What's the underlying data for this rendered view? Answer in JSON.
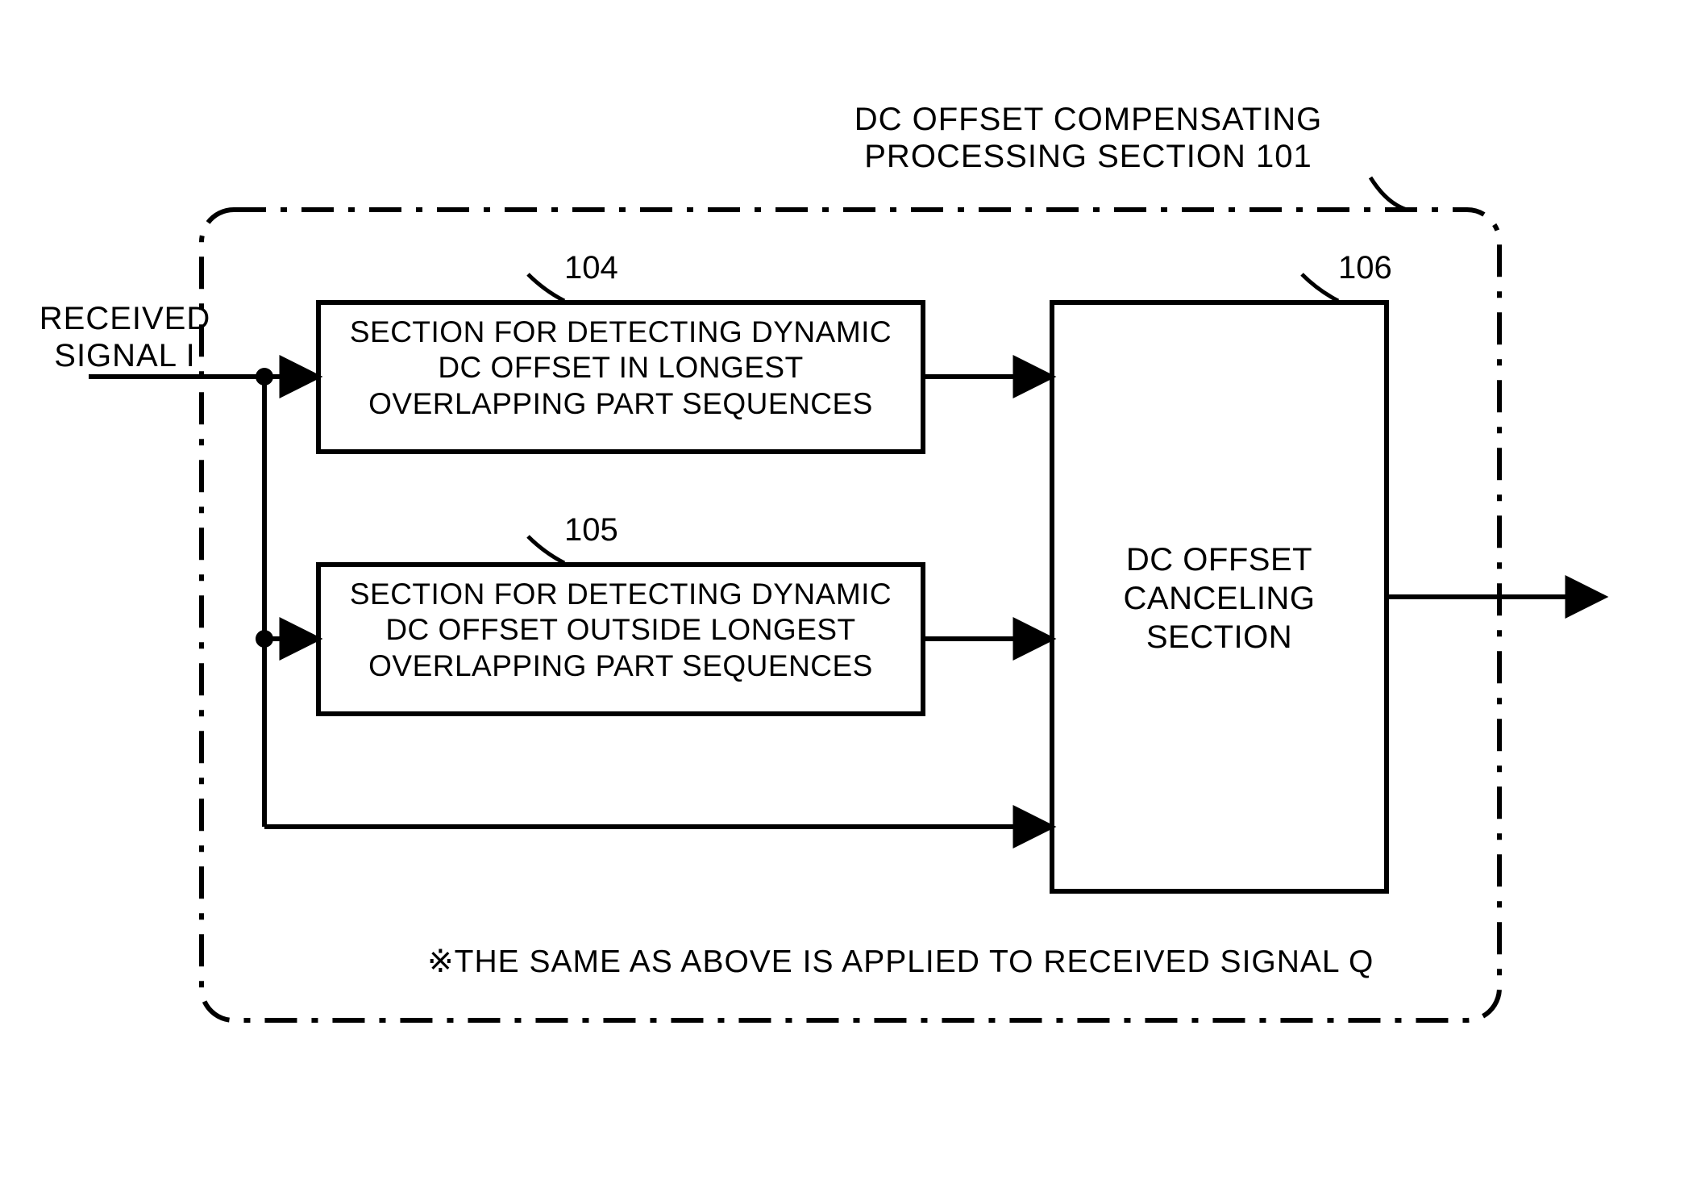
{
  "title": {
    "line1": "DC OFFSET COMPENSATING",
    "line2": "PROCESSING SECTION 101"
  },
  "input_label": {
    "line1": "RECEIVED",
    "line2": "SIGNAL I"
  },
  "block104": {
    "ref": "104",
    "line1": "SECTION FOR DETECTING DYNAMIC",
    "line2": "DC OFFSET IN LONGEST",
    "line3": "OVERLAPPING PART SEQUENCES"
  },
  "block105": {
    "ref": "105",
    "line1": "SECTION FOR DETECTING DYNAMIC",
    "line2": "DC OFFSET OUTSIDE LONGEST",
    "line3": "OVERLAPPING PART SEQUENCES"
  },
  "block106": {
    "ref": "106",
    "line1": "DC OFFSET",
    "line2": "CANCELING",
    "line3": "SECTION"
  },
  "footnote": "※THE SAME AS ABOVE IS APPLIED TO RECEIVED SIGNAL Q"
}
